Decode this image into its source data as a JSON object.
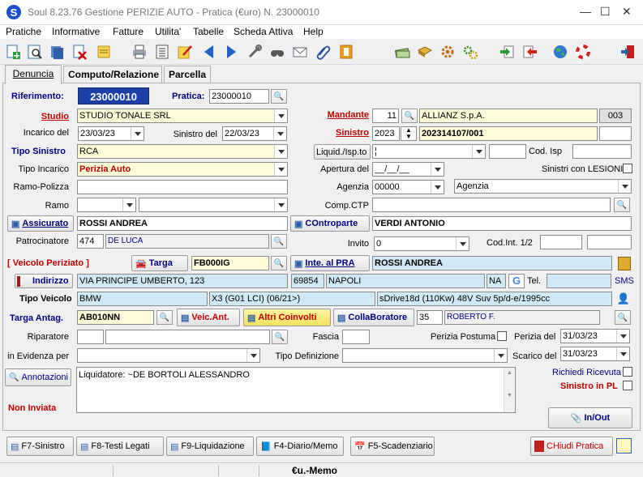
{
  "window": {
    "title": "Soul 8.23.76 Gestione PERIZIE AUTO - Pratica (€uro) N. 23000010",
    "minimize": "—",
    "maximize": "☐",
    "close": "✕",
    "app_icon": "s-logo-icon"
  },
  "menu": [
    "Pratiche",
    "Informative",
    "Fatture",
    "Utilita'",
    "Tabelle",
    "Scheda Attiva",
    "Help"
  ],
  "toolbar_icons": [
    "new-doc-icon",
    "search-doc-icon",
    "stack-icon",
    "delete-doc-icon",
    "note-icon",
    "printer-icon",
    "list-icon",
    "edit-doc-icon",
    "arrow-left-icon",
    "arrow-right-icon",
    "tools-icon",
    "binoculars-icon",
    "envelope-icon",
    "paperclip-icon",
    "folder-tab-icon",
    "money-icon",
    "book-icon",
    "gear-icon",
    "gears-icon",
    "import-icon",
    "export-icon",
    "globe-icon",
    "lifebuoy-icon",
    "exit-icon"
  ],
  "tabs": [
    "Denuncia",
    "Computo/Relazione",
    "Parcella"
  ],
  "labels": {
    "riferimento": "Riferimento:",
    "pratica": "Pratica:",
    "studio": "Studio",
    "mandante": "Mandante",
    "incarico_del": "Incarico del",
    "sinistro_del": "Sinistro del",
    "sinistro": "Sinistro",
    "tipo_sinistro": "Tipo Sinistro",
    "liquid_isp": "Liquid./Isp.to",
    "cod_isp": "Cod. Isp",
    "tipo_incarico": "Tipo Incarico",
    "apertura_del": "Apertura del",
    "sinistri_lesioni": "Sinistri con LESIONI",
    "ramo_polizza": "Ramo-Polizza",
    "agenzia": "Agenzia",
    "ramo": "Ramo",
    "comp_ctp": "Comp.CTP",
    "patrocinatore": "Patrocinatore",
    "invito": "Invito",
    "cod_int": "Cod.Int. 1/2",
    "veicolo_periziato": "[ Veicolo Periziato ]",
    "tel": "Tel.",
    "sms": "SMS",
    "tipo_veicolo": "Tipo Veicolo",
    "targa_antag": "Targa Antag.",
    "riparatore": "Riparatore",
    "fascia": "Fascia",
    "perizia_postuma": "Perizia Postuma",
    "perizia_del": "Perizia del",
    "in_evidenza_per": "in Evidenza per",
    "tipo_definizione": "Tipo Definizione",
    "scarico_del": "Scarico del",
    "richiedi_ricevuta": "Richiedi Ricevuta",
    "sinistro_in_pl": "Sinistro in PL",
    "non_inviata": "Non Inviata"
  },
  "fields": {
    "riferimento": "23000010",
    "pratica": "23000010",
    "studio": "STUDIO TONALE SRL",
    "mandante_code": "11",
    "mandante": "ALLIANZ S.p.A.",
    "mandante_num": "003",
    "incarico_del": "23/03/23",
    "sinistro_del": "22/03/23",
    "sinistro_year": "2023",
    "sinistro_num": "202314107/001",
    "tipo_sinistro": "RCA",
    "liquid_isp": "¦",
    "tipo_incarico": "Perizia Auto",
    "apertura_del": "__/__/__",
    "agenzia_code": "00000",
    "agenzia": "Agenzia",
    "assicurato": "ROSSI ANDREA",
    "controparte": "VERDI ANTONIO",
    "patrocinatore_code": "474",
    "patrocinatore": "DE LUCA",
    "invito": "0",
    "targa": "FB000IG",
    "intestatario": "ROSSI ANDREA",
    "indirizzo": "VIA PRINCIPE UMBERTO, 123",
    "cap": "69854",
    "citta": "NAPOLI",
    "provincia": "NA",
    "marca": "BMW",
    "modello": "X3 (G01 LCI) (06/21>)",
    "versione": "sDrive18d (110Kw) 48V Suv 5p/d-e/1995cc",
    "targa_antag": "AB010NN",
    "collaboratore_code": "35",
    "collaboratore": "ROBERTO F.",
    "perizia_del": "31/03/23",
    "scarico_del": "31/03/23",
    "annotazioni": "Liquidatore: ~DE BORTOLI ALESSANDRO"
  },
  "buttons": {
    "assicurato": "Assicurato",
    "controparte": "COntroparte",
    "targa": "Targa",
    "intestatario": "Inte. al PRA",
    "indirizzo": "Indirizzo",
    "veic_ant": "Veic.Ant.",
    "altri_coinvolti": "Altri Coinvolti",
    "collaboratore": "CollaBoratore",
    "annotazioni": "Annotazioni",
    "in_out": "In/Out",
    "f7": "F7-Sinistro",
    "f8": "F8-Testi Legati",
    "f9": "F9-Liquidazione",
    "f4": "F4-Diario/Memo",
    "f5": "F5-Scadenziario",
    "chiudi": "CHiudi Pratica"
  },
  "status": {
    "text": "€u.-Memo"
  },
  "colors": {
    "accent_blue": "#000080",
    "label_red": "#c00000",
    "ref_blue": "#1c3fa8",
    "yellow_field": "#fdfbd8",
    "cyan_field": "#cfeaf6"
  }
}
